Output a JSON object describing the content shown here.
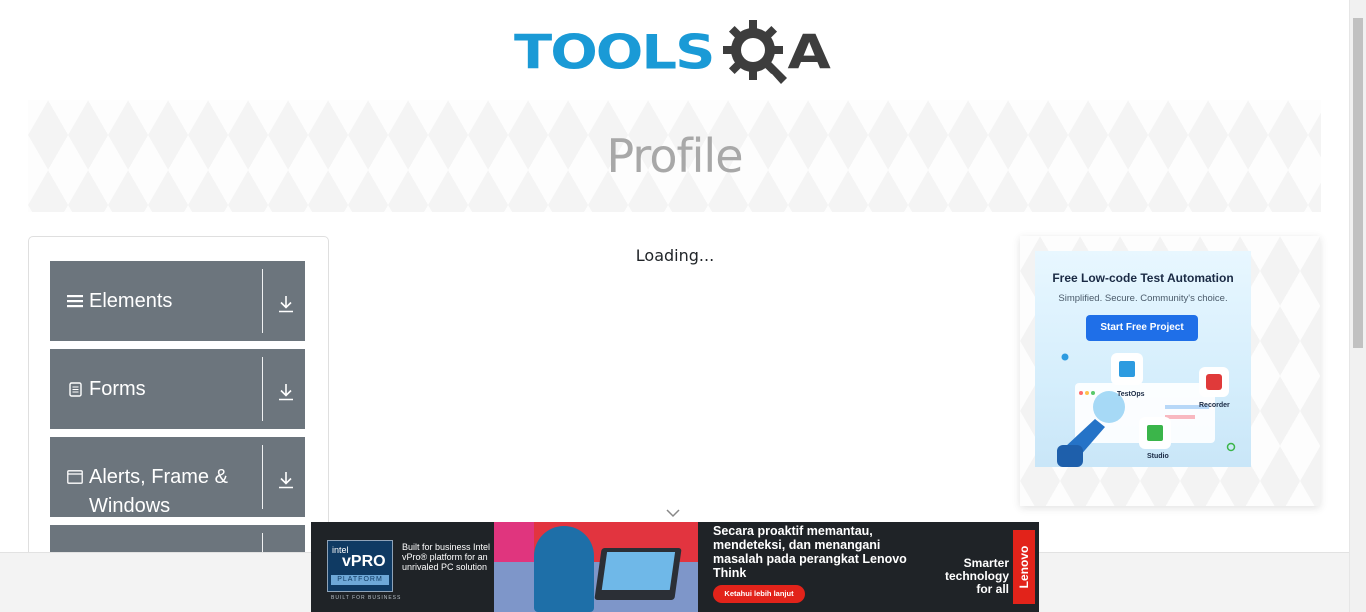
{
  "logo": {
    "tools": "TOOLS",
    "a": "A",
    "gear_icon": "gear-magnifier-icon",
    "colors": {
      "tools": "#1a9ad6",
      "a": "#3d3d3d"
    }
  },
  "banner": {
    "title": "Profile"
  },
  "sidebar": {
    "groups": [
      {
        "label": "Elements",
        "icon": "hamburger-icon"
      },
      {
        "label": "Forms",
        "icon": "document-icon"
      },
      {
        "label": "Alerts, Frame & Windows",
        "icon": "window-icon"
      },
      {
        "label": "",
        "icon": ""
      }
    ],
    "colors": {
      "group_bg": "#6c757d"
    }
  },
  "main": {
    "loading_text": "Loading..."
  },
  "right_ad": {
    "title": "Free Low-code Test Automation",
    "subtitle": "Simplified. Secure. Community's choice.",
    "button": "Start Free Project",
    "labels": {
      "testops": "TestOps",
      "recorder": "Recorder",
      "studio": "Studio"
    }
  },
  "bottom_ad": {
    "intel_brand": "intel",
    "intel_product": "vPRO",
    "intel_platform": "PLATFORM",
    "intel_tag": "BUILT FOR BUSINESS",
    "intel_copy": "Built for business Intel vPro® platform for an unrivaled PC solution",
    "headline": "Secara proaktif memantau, mendeteksi, dan menangani masalah pada perangkat Lenovo Think",
    "cta": "Ketahui lebih lanjut",
    "tagline": "Smarter technology for all",
    "brand": "Lenovo"
  }
}
